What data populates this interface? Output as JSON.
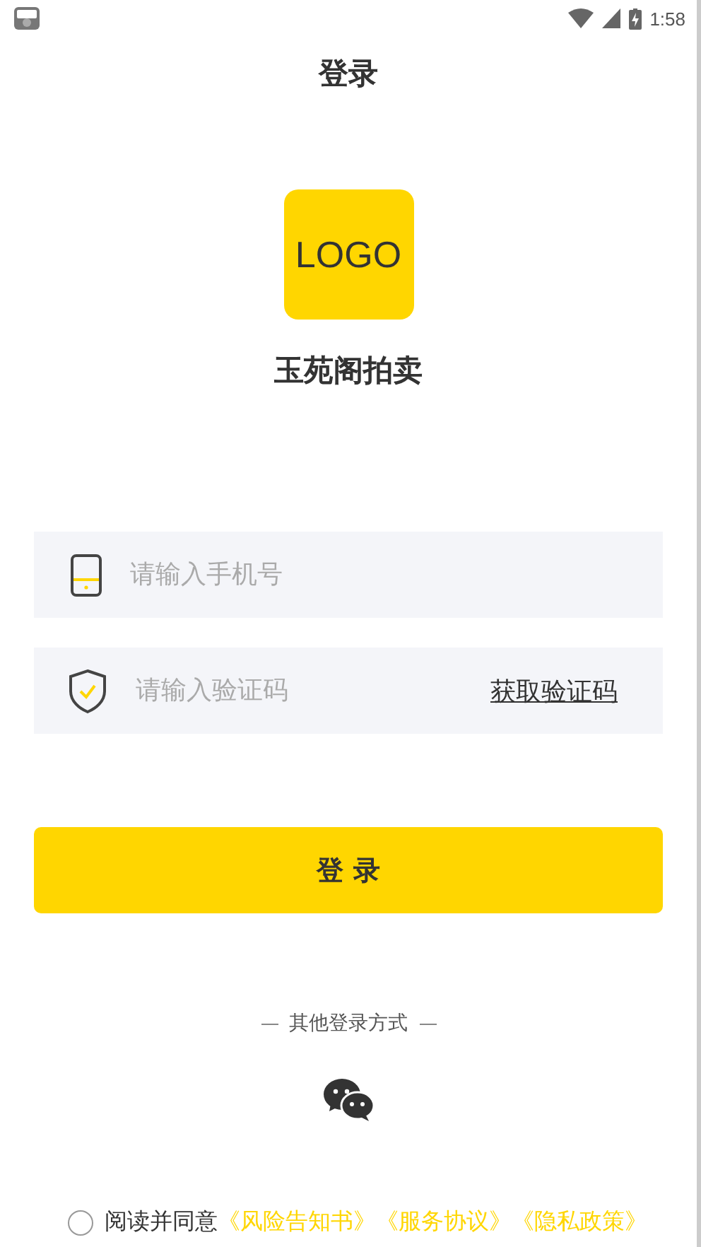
{
  "status_bar": {
    "time": "1:58"
  },
  "title": "登录",
  "logo": {
    "text": "LOGO"
  },
  "app_name": "玉苑阁拍卖",
  "phone_field": {
    "placeholder": "请输入手机号"
  },
  "code_field": {
    "placeholder": "请输入验证码",
    "action": "获取验证码"
  },
  "login_button": "登 录",
  "other_login": {
    "label": "其他登录方式"
  },
  "agreement": {
    "agreed": false,
    "text": "阅读并同意",
    "links": [
      "《风险告知书》",
      "《服务协议》",
      "《隐私政策》"
    ]
  }
}
